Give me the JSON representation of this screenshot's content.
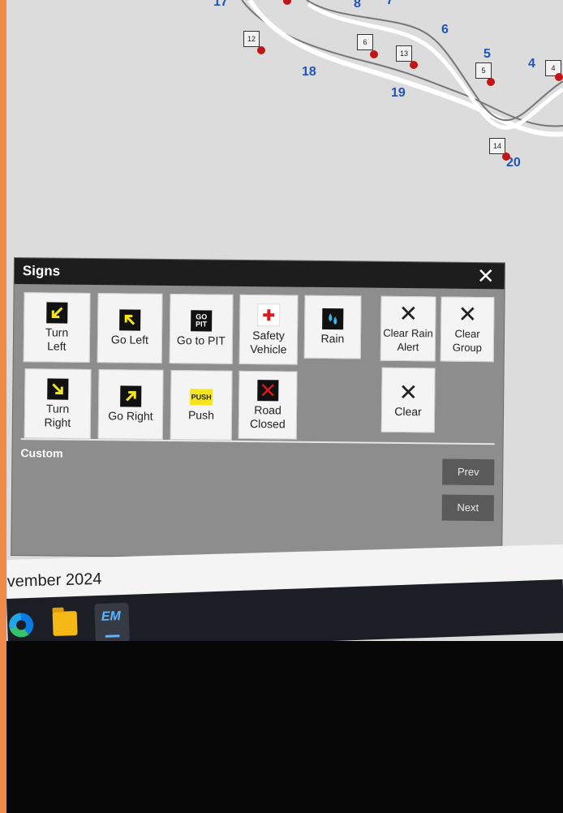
{
  "map": {
    "labels": [
      "17",
      "8",
      "7",
      "6",
      "5",
      "4",
      "18",
      "19",
      "20"
    ],
    "turn_boxes": [
      "12",
      "6",
      "13",
      "5",
      "4",
      "14"
    ]
  },
  "signs_panel": {
    "title": "Signs",
    "close_glyph": "✕",
    "buttons": {
      "turn_left": "Turn Left",
      "go_left": "Go Left",
      "go_to_pit": "Go to PIT",
      "go_pit_icon": "GO PIT",
      "safety_vehicle": "Safety Vehicle",
      "rain": "Rain",
      "clear_rain_alert": "Clear Rain Alert",
      "clear_group": "Clear Group",
      "turn_right": "Turn Right",
      "go_right": "Go Right",
      "push": "Push",
      "push_icon": "PUSH",
      "road_closed": "Road Closed",
      "clear": "Clear"
    },
    "custom_label": "Custom",
    "prev_label": "Prev",
    "next_label": "Next"
  },
  "date_strip": {
    "text": "vember 2024"
  },
  "taskbar": {
    "app_icon_text": "EM"
  },
  "colors": {
    "panel_bg": "#8d8d8d",
    "header_bg": "#1d1d1d",
    "map_label": "#1f55b8",
    "marker_red": "#c21616",
    "arrow_yellow": "#f4e61a"
  }
}
